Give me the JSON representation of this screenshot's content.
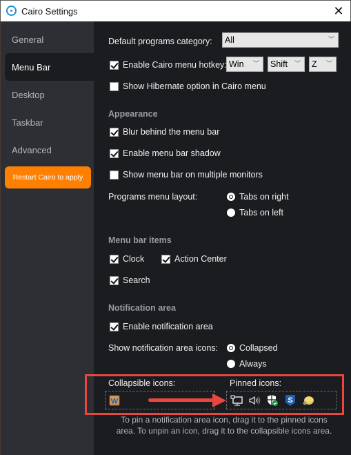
{
  "window": {
    "title": "Cairo Settings",
    "close_icon": "close-icon",
    "app_icon": "cairo-logo-icon"
  },
  "sidebar": {
    "items": [
      {
        "label": "General",
        "active": false
      },
      {
        "label": "Menu Bar",
        "active": true
      },
      {
        "label": "Desktop",
        "active": false
      },
      {
        "label": "Taskbar",
        "active": false
      },
      {
        "label": "Advanced",
        "active": false
      }
    ],
    "restart_button": "Restart Cairo to apply",
    "accent_color": "#ff8000"
  },
  "main": {
    "default_programs": {
      "label": "Default programs category:",
      "value": "All"
    },
    "hotkey": {
      "label": "Enable Cairo menu hotkey:",
      "checked": true,
      "modifier1": "Win",
      "modifier2": "Shift",
      "key": "Z"
    },
    "hibernate": {
      "label": "Show Hibernate option in Cairo menu",
      "checked": false
    },
    "appearance": {
      "heading": "Appearance",
      "blur": {
        "label": "Blur behind the menu bar",
        "checked": true
      },
      "shadow": {
        "label": "Enable menu bar shadow",
        "checked": true
      },
      "multi_monitor": {
        "label": "Show menu bar on multiple monitors",
        "checked": false
      },
      "layout_label": "Programs menu layout:",
      "layout_options": [
        {
          "label": "Tabs on right",
          "selected": true
        },
        {
          "label": "Tabs on left",
          "selected": false
        }
      ]
    },
    "menu_bar_items": {
      "heading": "Menu bar items",
      "clock": {
        "label": "Clock",
        "checked": true
      },
      "action_center": {
        "label": "Action Center",
        "checked": true
      },
      "search": {
        "label": "Search",
        "checked": true
      }
    },
    "notification_area": {
      "heading": "Notification area",
      "enable": {
        "label": "Enable notification area",
        "checked": true
      },
      "show_icons_label": "Show notification area icons:",
      "show_icons_options": [
        {
          "label": "Collapsed",
          "selected": true
        },
        {
          "label": "Always",
          "selected": false
        }
      ],
      "collapsible_label": "Collapsible icons:",
      "pinned_label": "Pinned icons:",
      "collapsible_icons": [
        "word-icon"
      ],
      "pinned_icons": [
        "network-icon",
        "volume-icon",
        "windows-security-icon",
        "sophos-icon",
        "usb-drive-icon"
      ],
      "help_text": "To pin a notification area icon, drag it to the pinned icons area. To unpin an icon, drag it to the collapsible icons area."
    }
  },
  "annotation": {
    "highlight_color": "#e8463f"
  }
}
